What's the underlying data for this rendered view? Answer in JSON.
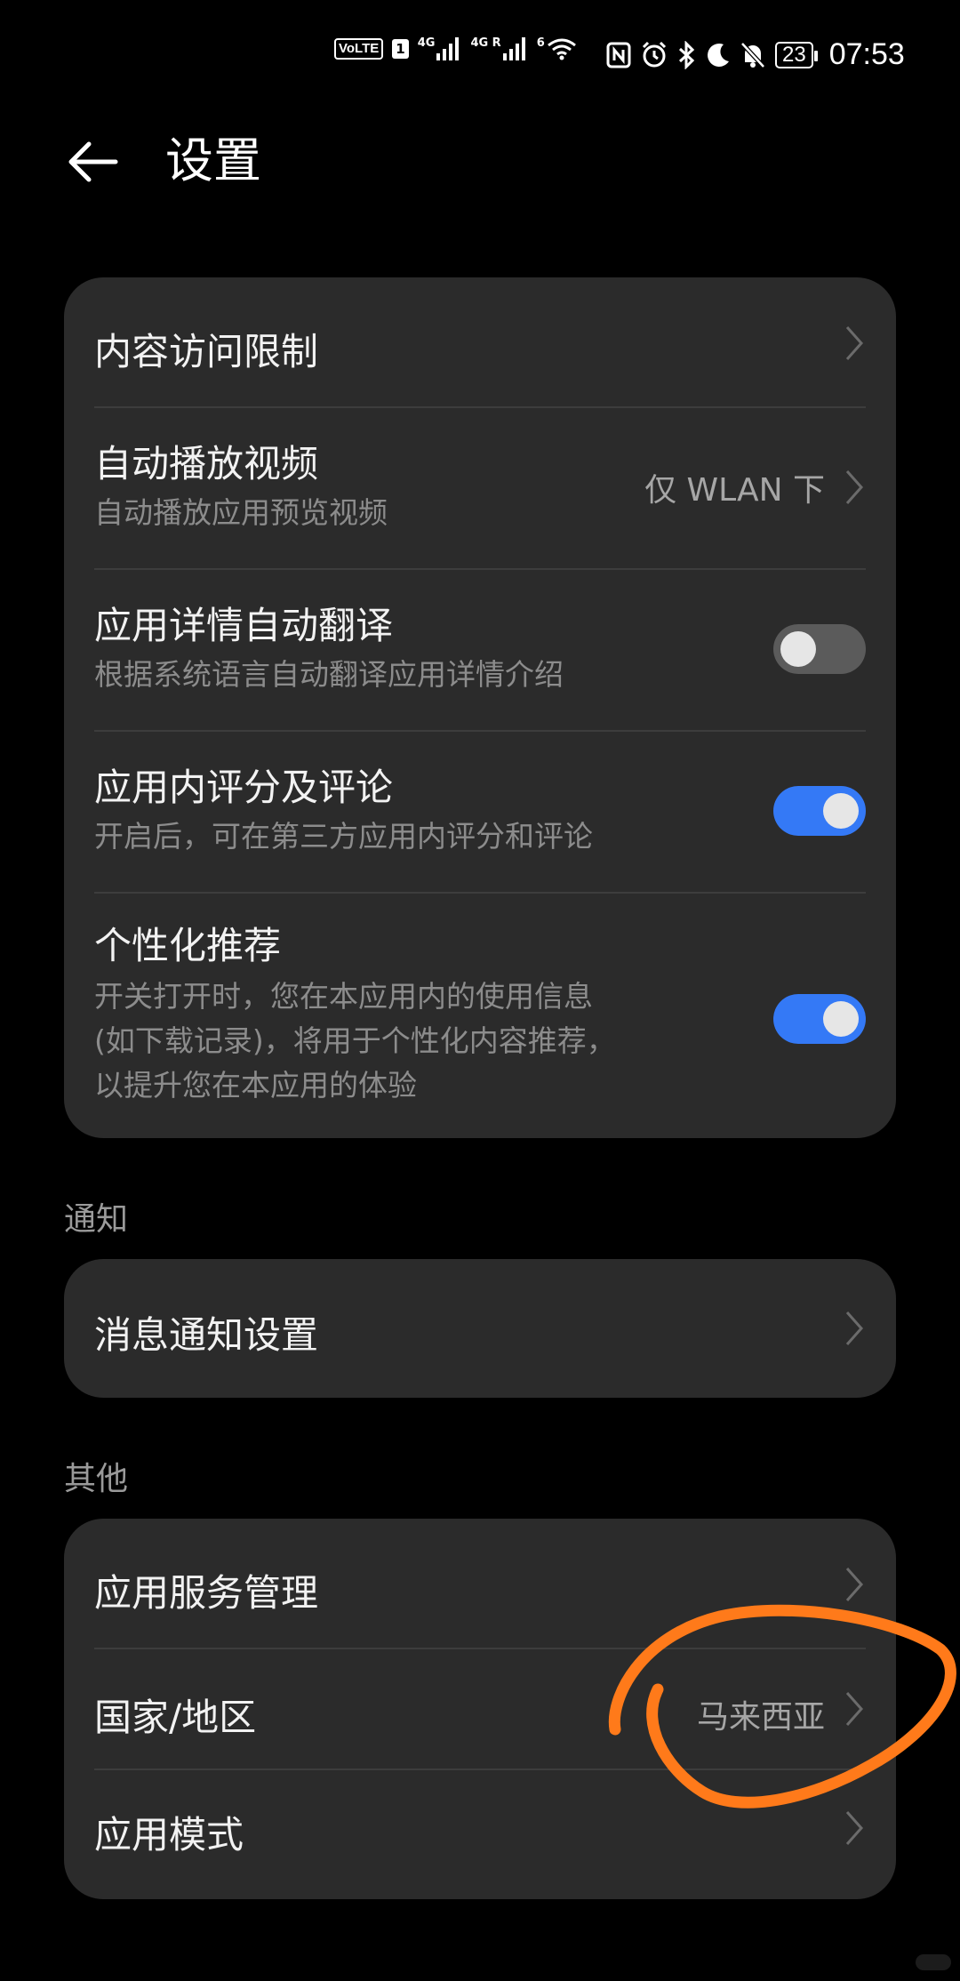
{
  "status_bar": {
    "volte": "VoLTE",
    "sim": "1",
    "net1": "4G",
    "net2": "4G R",
    "wifi_gen": "6",
    "battery": "23",
    "time": "07:53",
    "icons": [
      "nfc-icon",
      "alarm-icon",
      "bluetooth-icon",
      "moon-icon",
      "mute-icon"
    ]
  },
  "header": {
    "title": "设置",
    "back_icon": "arrow-left-icon"
  },
  "card1": {
    "items": [
      {
        "title": "内容访问限制"
      },
      {
        "title": "自动播放视频",
        "subtitle": "自动播放应用预览视频",
        "value": "仅 WLAN 下"
      },
      {
        "title": "应用详情自动翻译",
        "subtitle": "根据系统语言自动翻译应用详情介绍",
        "toggle": false
      },
      {
        "title": "应用内评分及评论",
        "subtitle": "开启后，可在第三方应用内评分和评论",
        "toggle": true
      },
      {
        "title": "个性化推荐",
        "subtitle_lines": [
          "开关打开时，您在本应用内的使用信息",
          "(如下载记录)，将用于个性化内容推荐，",
          "以提升您在本应用的体验"
        ],
        "toggle": true
      }
    ]
  },
  "notifications": {
    "label": "通知",
    "items": [
      {
        "title": "消息通知设置"
      }
    ]
  },
  "other": {
    "label": "其他",
    "items": [
      {
        "title": "应用服务管理"
      },
      {
        "title": "国家/地区",
        "value": "马来西亚"
      },
      {
        "title": "应用模式"
      }
    ]
  },
  "colors": {
    "background": "#000000",
    "card": "#2b2b2b",
    "toggle_on": "#3479f6",
    "toggle_off": "#5b5b5b",
    "annotation": "#ff7a1a"
  }
}
